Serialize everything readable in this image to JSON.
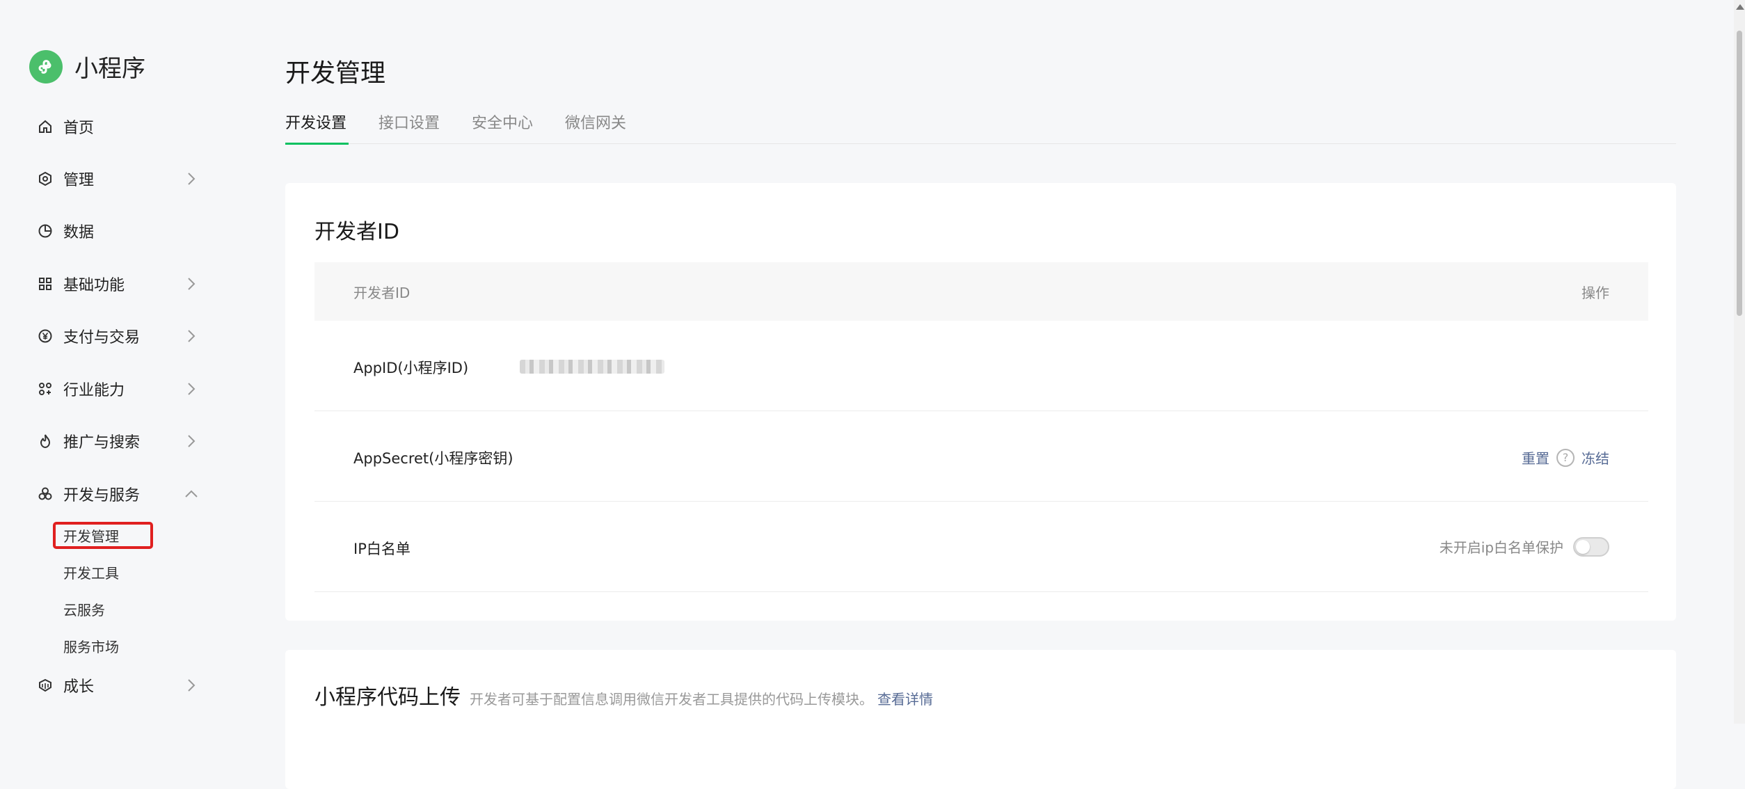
{
  "brand": {
    "name": "小程序",
    "logo_icon": "mini-program-logo-icon",
    "logo_color": "#4bbf6b"
  },
  "sidebar": {
    "items": [
      {
        "label": "首页",
        "icon": "home-icon"
      },
      {
        "label": "管理",
        "icon": "manage-icon",
        "expandable": true
      },
      {
        "label": "数据",
        "icon": "chart-pie-icon"
      },
      {
        "label": "基础功能",
        "icon": "grid-icon",
        "expandable": true
      },
      {
        "label": "支付与交易",
        "icon": "yen-icon",
        "expandable": true
      },
      {
        "label": "行业能力",
        "icon": "industry-icon",
        "expandable": true
      },
      {
        "label": "推广与搜索",
        "icon": "flame-icon",
        "expandable": true
      },
      {
        "label": "开发与服务",
        "icon": "dev-service-icon",
        "expandable": true,
        "expanded": true
      },
      {
        "label": "成长",
        "icon": "growth-icon",
        "expandable": true
      }
    ],
    "sub_items": [
      "开发管理",
      "开发工具",
      "云服务",
      "服务市场"
    ],
    "active_sub": "开发管理"
  },
  "main": {
    "title": "开发管理",
    "tabs": [
      {
        "label": "开发设置",
        "active": true
      },
      {
        "label": "接口设置"
      },
      {
        "label": "安全中心"
      },
      {
        "label": "微信网关"
      }
    ],
    "developer_id": {
      "title": "开发者ID",
      "header_left": "开发者ID",
      "header_right": "操作",
      "rows": [
        {
          "label": "AppID(小程序ID)"
        },
        {
          "label": "AppSecret(小程序密钥)",
          "actions": [
            "重置",
            "冻结"
          ]
        },
        {
          "label": "IP白名单",
          "status": "未开启ip白名单保护",
          "toggle_on": false
        }
      ]
    },
    "upload": {
      "title": "小程序代码上传",
      "desc": "开发者可基于配置信息调用微信开发者工具提供的代码上传模块。",
      "link": "查看详情"
    }
  },
  "colors": {
    "accent": "#07c160",
    "link": "#576b95",
    "highlight_box": "#e02020"
  }
}
